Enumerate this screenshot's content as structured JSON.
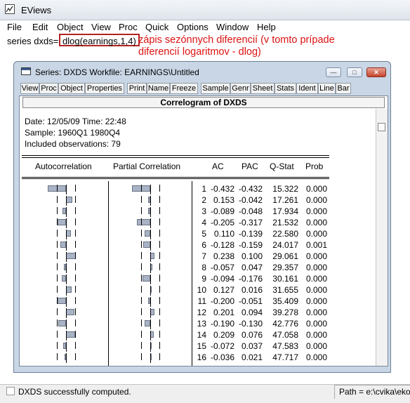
{
  "app": {
    "title": "EViews"
  },
  "menu": [
    "File",
    "Edit",
    "Object",
    "View",
    "Proc",
    "Quick",
    "Options",
    "Window",
    "Help"
  ],
  "command": {
    "prefix": "series dxds=",
    "highlight": "dlog(earnings,1,4)",
    "annotation_line1": "zápis sezónnych diferencií (v tomto prípade",
    "annotation_line2": "diferencií logaritmov - dlog)"
  },
  "series_window": {
    "title": "Series: DXDS   Workfile: EARNINGS\\Untitled",
    "toolbar": [
      "View",
      "Proc",
      "Object",
      "Properties",
      "Print",
      "Name",
      "Freeze",
      "Sample",
      "Genr",
      "Sheet",
      "Stats",
      "Ident",
      "Line",
      "Bar"
    ],
    "header": "Correlogram of DXDS",
    "date_line": "Date: 12/05/09   Time: 22:48",
    "sample_line": "Sample: 1960Q1 1980Q4",
    "obs_line": "Included observations: 79",
    "columns": {
      "autocorrelation": "Autocorrelation",
      "partial": "Partial Correlation",
      "ac": "AC",
      "pac": "PAC",
      "qstat": "Q-Stat",
      "prob": "Prob"
    },
    "rows": [
      {
        "lag": "1",
        "ac": "-0.432",
        "pac": "-0.432",
        "q": "15.322",
        "prob": "0.000"
      },
      {
        "lag": "2",
        "ac": "0.153",
        "pac": "-0.042",
        "q": "17.261",
        "prob": "0.000"
      },
      {
        "lag": "3",
        "ac": "-0.089",
        "pac": "-0.048",
        "q": "17.934",
        "prob": "0.000"
      },
      {
        "lag": "4",
        "ac": "-0.205",
        "pac": "-0.317",
        "q": "21.532",
        "prob": "0.000"
      },
      {
        "lag": "5",
        "ac": "0.110",
        "pac": "-0.139",
        "q": "22.580",
        "prob": "0.000"
      },
      {
        "lag": "6",
        "ac": "-0.128",
        "pac": "-0.159",
        "q": "24.017",
        "prob": "0.001"
      },
      {
        "lag": "7",
        "ac": "0.238",
        "pac": "0.100",
        "q": "29.061",
        "prob": "0.000"
      },
      {
        "lag": "8",
        "ac": "-0.057",
        "pac": "0.047",
        "q": "29.357",
        "prob": "0.000"
      },
      {
        "lag": "9",
        "ac": "-0.094",
        "pac": "-0.176",
        "q": "30.161",
        "prob": "0.000"
      },
      {
        "lag": "10",
        "ac": "0.127",
        "pac": "0.016",
        "q": "31.655",
        "prob": "0.000"
      },
      {
        "lag": "11",
        "ac": "-0.200",
        "pac": "-0.051",
        "q": "35.409",
        "prob": "0.000"
      },
      {
        "lag": "12",
        "ac": "0.201",
        "pac": "0.094",
        "q": "39.278",
        "prob": "0.000"
      },
      {
        "lag": "13",
        "ac": "-0.190",
        "pac": "-0.130",
        "q": "42.776",
        "prob": "0.000"
      },
      {
        "lag": "14",
        "ac": "0.209",
        "pac": "0.076",
        "q": "47.058",
        "prob": "0.000"
      },
      {
        "lag": "15",
        "ac": "-0.072",
        "pac": "0.037",
        "q": "47.583",
        "prob": "0.000"
      },
      {
        "lag": "16",
        "ac": "-0.036",
        "pac": "0.021",
        "q": "47.717",
        "prob": "0.000"
      }
    ]
  },
  "status": {
    "text": "DXDS successfully computed.",
    "path": "Path = e:\\cvika\\ekon"
  },
  "colors": {
    "annotation": "#dd1111",
    "highlight_border": "#b22222"
  }
}
